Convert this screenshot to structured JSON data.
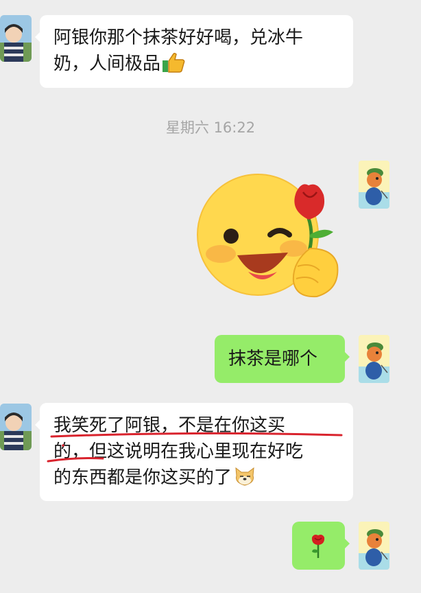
{
  "messages": [
    {
      "side": "left",
      "text": "阿银你那个抹茶好好喝，兑冰牛奶，人间极品",
      "emoji": "👍"
    },
    {
      "timestamp": "星期六 16:22"
    },
    {
      "side": "right",
      "sticker": "smiling-face-holding-rose-sticker"
    },
    {
      "side": "right",
      "text": "抹茶是哪个"
    },
    {
      "side": "left",
      "text_line1": "我笑死了阿银，不是在你这买",
      "text_line2": "的，但这说明在我心里现在好吃",
      "text_line3": "的东西都是你这买的了"
    },
    {
      "side": "right",
      "emoji": "🌹"
    }
  ],
  "msg1": {
    "line1": "阿银你那个抹茶好好喝，兑冰牛",
    "line2": "奶，人间极品"
  },
  "time": "星期六 16:22",
  "msg3": "抹茶是哪个",
  "colors": {
    "background": "#ededed",
    "incoming_bubble": "#ffffff",
    "outgoing_bubble": "#95ec69",
    "annotation_underline": "#d9232d"
  },
  "icons": {
    "thumbs_up": "thumbs-up-icon",
    "doge": "doge-emoji-icon",
    "rose": "rose-icon"
  }
}
